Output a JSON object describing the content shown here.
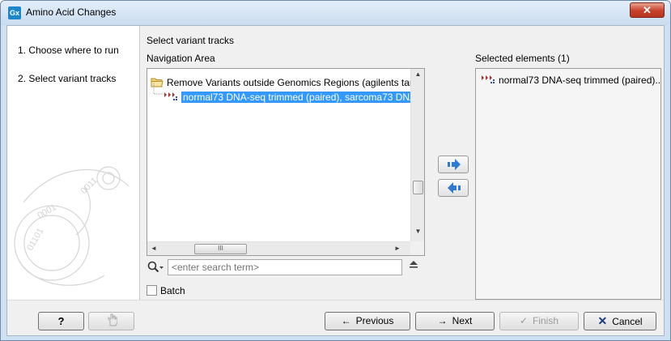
{
  "window": {
    "app_icon_text": "Gx",
    "title": "Amino Acid Changes",
    "close_glyph": "✕"
  },
  "steps": {
    "items": [
      {
        "label": "1.  Choose where to run"
      },
      {
        "label": "2.  Select variant tracks"
      }
    ]
  },
  "main": {
    "section_title": "Select variant tracks",
    "navigation_label": "Navigation Area",
    "selected_label": "Selected elements (1)",
    "tree": {
      "folder_label": "Remove Variants outside Genomics Regions (agilents targ",
      "track_label": "normal73 DNA-seq trimmed (paired), sarcoma73 DNA"
    },
    "hscroll_thumb_grip": "III",
    "search": {
      "placeholder": "<enter search term>",
      "value": "<enter search term>"
    },
    "batch_label": "Batch",
    "selected_items": [
      {
        "label": "normal73 DNA-seq trimmed (paired)..."
      }
    ]
  },
  "footer": {
    "help_label": "?",
    "previous_label": "Previous",
    "next_label": "Next",
    "finish_label": "Finish",
    "cancel_label": "Cancel"
  },
  "colors": {
    "selection": "#3399ff",
    "arrow_blue": "#2e7bd1",
    "cancel_x": "#1a3a7a"
  }
}
